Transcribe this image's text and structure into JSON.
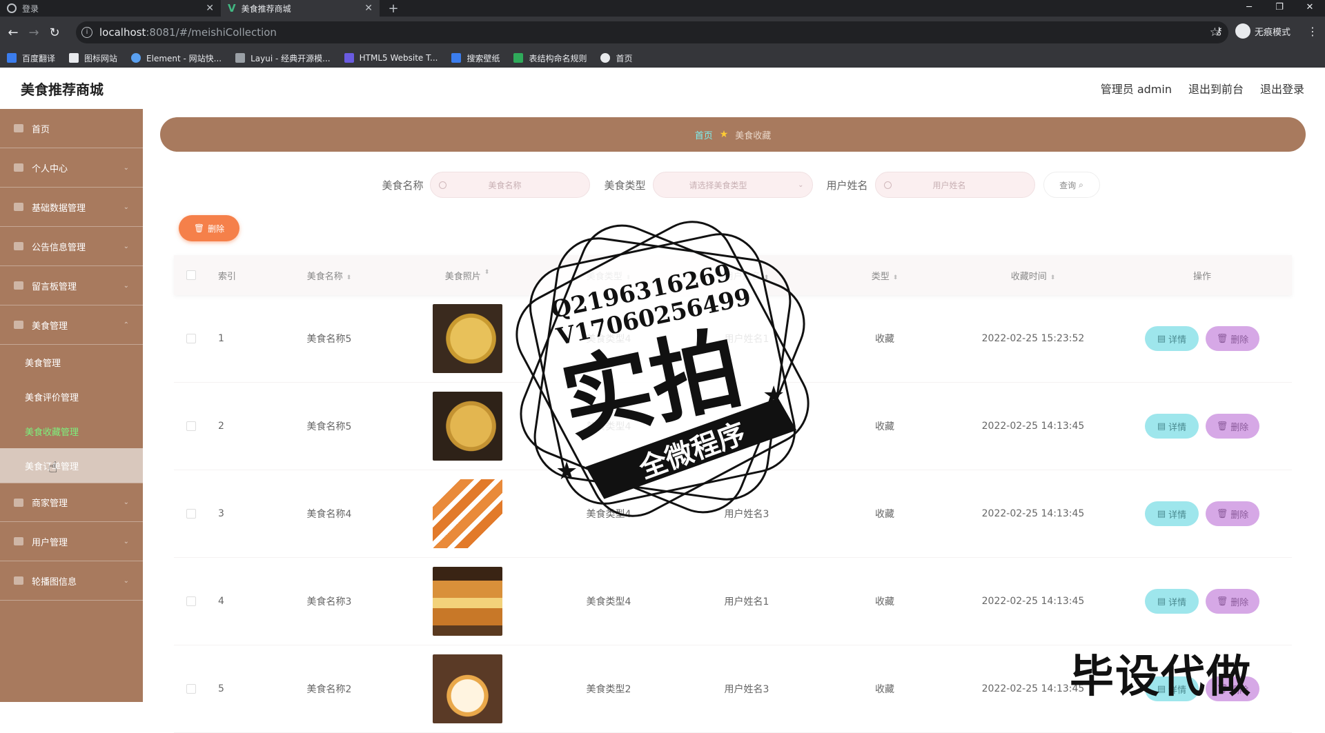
{
  "browser": {
    "tabs": [
      {
        "label": "登录"
      },
      {
        "label": "美食推荐商城"
      }
    ],
    "new_tab": "+",
    "url_host": "localhost",
    "url_path": ":8081/#/meishiCollection",
    "incognito_label": "无痕模式",
    "bookmarks": [
      "百度翻译",
      "图标网站",
      "Element - 网站快...",
      "Layui - 经典开源模...",
      "HTML5 Website T...",
      "搜索壁纸",
      "表结构命名规则",
      "首页"
    ]
  },
  "header": {
    "title": "美食推荐商城",
    "admin": "管理员 admin",
    "front": "退出到前台",
    "logout": "退出登录"
  },
  "sidebar": {
    "items": [
      {
        "label": "首页"
      },
      {
        "label": "个人中心"
      },
      {
        "label": "基础数据管理"
      },
      {
        "label": "公告信息管理"
      },
      {
        "label": "留言板管理"
      },
      {
        "label": "美食管理"
      }
    ],
    "subitems": [
      {
        "label": "美食管理"
      },
      {
        "label": "美食评价管理"
      },
      {
        "label": "美食收藏管理"
      },
      {
        "label": "美食订单管理"
      }
    ],
    "items_after": [
      {
        "label": "商家管理"
      },
      {
        "label": "用户管理"
      },
      {
        "label": "轮播图信息"
      }
    ]
  },
  "breadcrumb": {
    "home": "首页",
    "current": "美食收藏"
  },
  "search": {
    "name_label": "美食名称",
    "name_placeholder": "美食名称",
    "type_label": "美食类型",
    "type_placeholder": "请选择美食类型",
    "user_label": "用户姓名",
    "user_placeholder": "用户姓名",
    "query": "查询"
  },
  "actions": {
    "delete": "删除"
  },
  "table": {
    "headers": [
      "索引",
      "美食名称",
      "美食照片",
      "美食类型",
      "用户姓名",
      "类型",
      "收藏时间",
      "操作"
    ],
    "rows": [
      {
        "idx": "1",
        "name": "美食名称5",
        "type": "美食类型4",
        "user": "用户姓名1",
        "kind": "收藏",
        "time": "2022-02-25 15:23:52"
      },
      {
        "idx": "2",
        "name": "美食名称5",
        "type": "美食类型4",
        "user": "用户姓名1",
        "kind": "收藏",
        "time": "2022-02-25 14:13:45"
      },
      {
        "idx": "3",
        "name": "美食名称4",
        "type": "美食类型4",
        "user": "用户姓名3",
        "kind": "收藏",
        "time": "2022-02-25 14:13:45"
      },
      {
        "idx": "4",
        "name": "美食名称3",
        "type": "美食类型4",
        "user": "用户姓名1",
        "kind": "收藏",
        "time": "2022-02-25 14:13:45"
      },
      {
        "idx": "5",
        "name": "美食名称2",
        "type": "美食类型2",
        "user": "用户姓名3",
        "kind": "收藏",
        "time": "2022-02-25 14:13:45"
      }
    ],
    "detail": "详情",
    "delete": "删除"
  },
  "watermark": {
    "line1": "Q2196316269",
    "line2": "V17060256499",
    "big": "实拍",
    "banner": "全微程序",
    "bottom": "毕设代做"
  }
}
